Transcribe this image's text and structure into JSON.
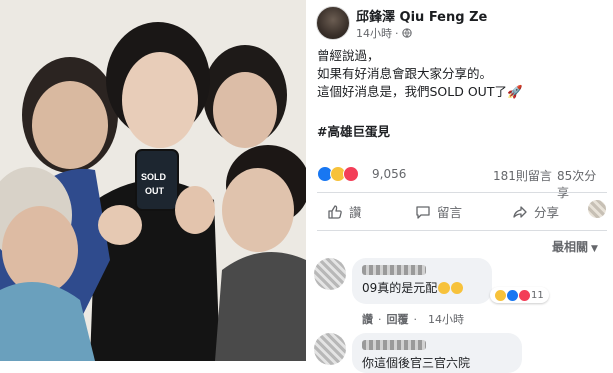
{
  "post": {
    "author": "邱鋒澤 Qiu Feng Ze",
    "time": "14小時",
    "text_lines": [
      "曾經說過，",
      "如果有好消息會跟大家分享的。",
      "這個好消息是，我們SOLD OUT了🚀"
    ],
    "hashtag": "#高雄巨蛋見",
    "reaction_count": "9,056",
    "comments_count": "181則留言",
    "shares_count": "85次分享"
  },
  "actions": {
    "like": "讚",
    "comment": "留言",
    "share": "分享"
  },
  "comments_sort": "最相關",
  "comments": [
    {
      "text": "09真的是元配",
      "reaction_count": "11",
      "like_label": "讚",
      "reply_label": "回覆",
      "time": "14小時"
    },
    {
      "text": "你這個後官三官六院"
    }
  ],
  "colors": {
    "like_blue": "#1877f2",
    "haha_yellow": "#f7c23b",
    "love_red": "#f33e58",
    "comment_bg": "#f0f2f5"
  },
  "icons": [
    "globe-icon",
    "like-icon",
    "comment-icon",
    "share-icon",
    "chevron-down-icon"
  ]
}
